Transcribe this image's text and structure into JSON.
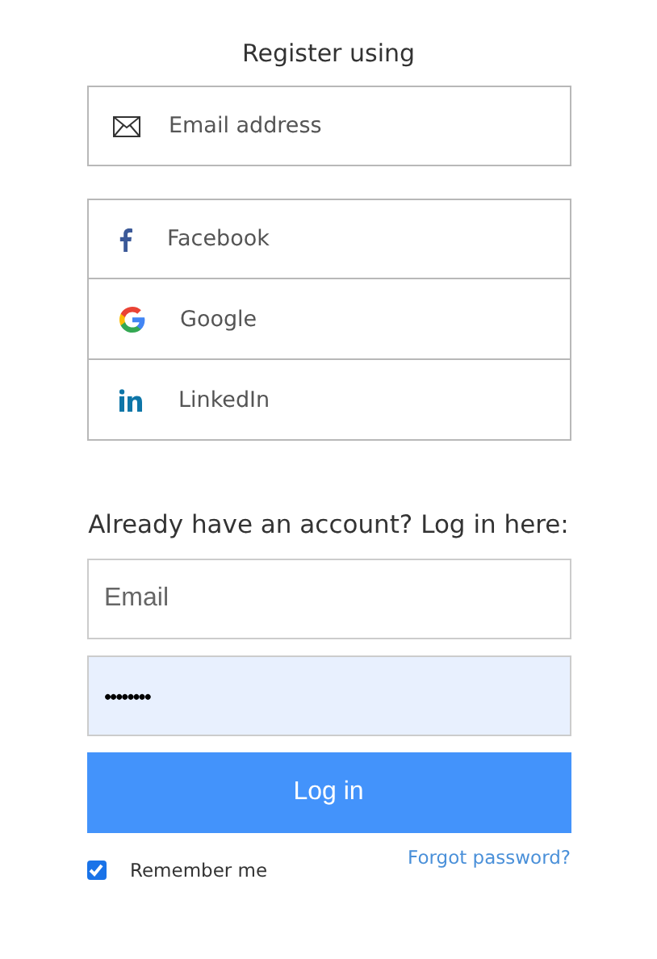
{
  "register": {
    "title": "Register using",
    "email_option": {
      "label": "Email address"
    },
    "providers": [
      {
        "kind": "facebook",
        "label": "Facebook"
      },
      {
        "kind": "google",
        "label": "Google"
      },
      {
        "kind": "linkedin",
        "label": "LinkedIn"
      }
    ]
  },
  "login": {
    "title": "Already have an account? Log in here:",
    "email": {
      "placeholder": "Email"
    },
    "password": {
      "value": "••••••••",
      "autofilled": true
    },
    "button": "Log in",
    "remember": {
      "label": "Remember me",
      "checked": true
    },
    "forgot": "Forgot password?"
  }
}
